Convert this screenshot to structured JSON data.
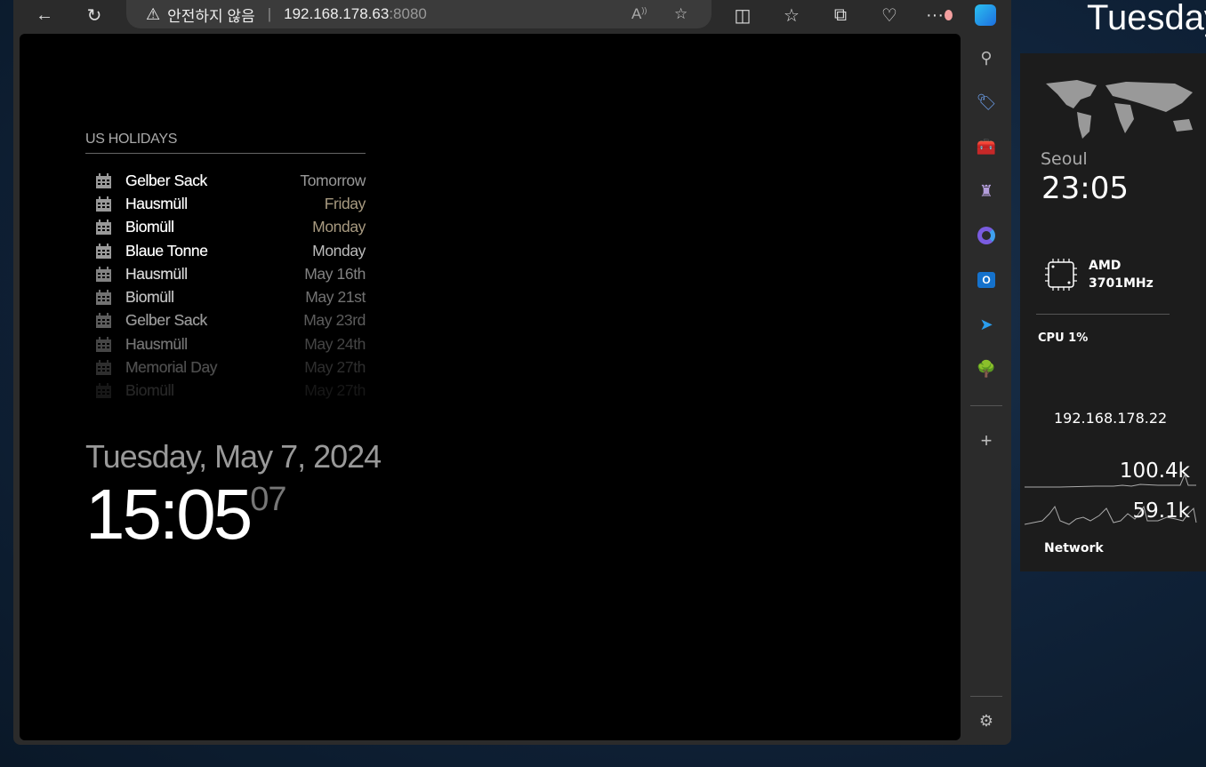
{
  "browser": {
    "security_warning": "안전하지 않음",
    "url_host": "192.168.178.63",
    "url_port": ":8080"
  },
  "holidays": {
    "title": "US HOLIDAYS",
    "events": [
      {
        "name": "Gelber Sack",
        "when": "Tomorrow"
      },
      {
        "name": "Hausmüll",
        "when": "Friday"
      },
      {
        "name": "Biomüll",
        "when": "Monday"
      },
      {
        "name": "Blaue Tonne",
        "when": "Monday"
      },
      {
        "name": "Hausmüll",
        "when": "May 16th"
      },
      {
        "name": "Biomüll",
        "when": "May 21st"
      },
      {
        "name": "Gelber Sack",
        "when": "May 23rd"
      },
      {
        "name": "Hausmüll",
        "when": "May 24th"
      },
      {
        "name": "Memorial Day",
        "when": "May 27th"
      },
      {
        "name": "Biomüll",
        "when": "May 27th"
      }
    ]
  },
  "clock": {
    "date": "Tuesday, May 7, 2024",
    "time": "15:05",
    "seconds": "07"
  },
  "desktop": {
    "day": "Tuesday"
  },
  "widget": {
    "city": "Seoul",
    "city_time": "23:05",
    "cpu_name": "AMD",
    "cpu_freq": "3701MHz",
    "cpu_label": "CPU 1%",
    "ip": "192.168.178.22",
    "net_up": "100.4k",
    "net_down": "59.1k",
    "net_label": "Network"
  }
}
